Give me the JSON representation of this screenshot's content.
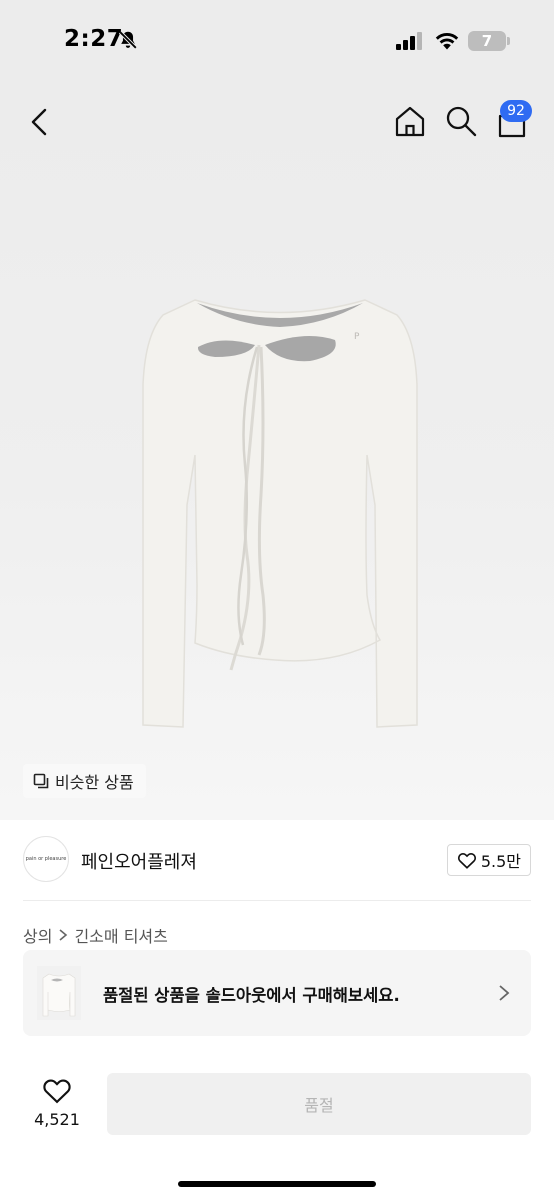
{
  "status_bar": {
    "time": "2:27",
    "battery_level": "7",
    "icons": [
      "bell-slash-icon",
      "cellular-signal-icon",
      "wifi-icon",
      "battery-icon"
    ]
  },
  "nav": {
    "icons": [
      "chevron-left-icon",
      "home-icon",
      "search-icon",
      "shopping-bag-icon"
    ],
    "bag_badge_count": "92"
  },
  "hero": {
    "similar_products_label": "비슷한 상품",
    "image_subject": "white long-sleeve cutout top with tie strings"
  },
  "brand": {
    "name": "페인오어플레져",
    "logo_text": "pain or pleasure",
    "likes": "5.5만"
  },
  "breadcrumb": {
    "items": [
      "상의",
      "긴소매 티셔츠"
    ]
  },
  "soldout_card": {
    "message": "품절된 상품을 솔드아웃에서 구매해보세요."
  },
  "bottom_bar": {
    "wish_count": "4,521",
    "purchase_button_label": "품절"
  },
  "colors": {
    "background": "#ffffff",
    "hero_background": "#ececec",
    "badge_blue": "#2f6bf2",
    "disabled_button": "#f0f0f0",
    "disabled_text": "#b5b5b5"
  }
}
